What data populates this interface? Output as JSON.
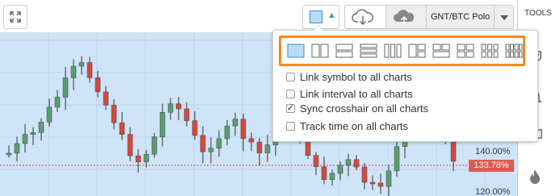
{
  "toolbar": {
    "symbol": "GNT/BTC Polo",
    "expand_icon": "expand-icon",
    "layout_icon": "layout-single-icon",
    "cloud_download_icon": "cloud-download-icon",
    "cloud_upload_icon": "cloud-upload-icon"
  },
  "sidebar": {
    "title": "TOOLS"
  },
  "chart": {
    "price_labels": [
      "140.00%",
      "120.00%"
    ],
    "current_price": "133.78%",
    "up_color": "#5a9e6f",
    "down_color": "#d34a3c"
  },
  "layout_menu": {
    "layouts": [
      "1",
      "2-vertical",
      "2-horizontal",
      "3-horizontal",
      "3-vertical",
      "3-left",
      "3-right",
      "4",
      "6",
      "8"
    ],
    "options": [
      {
        "label": "Link symbol to all charts",
        "checked": false
      },
      {
        "label": "Link interval to all charts",
        "checked": false
      },
      {
        "label": "Sync crosshair on all charts",
        "checked": true
      },
      {
        "label": "Track time on all charts",
        "checked": false
      }
    ]
  }
}
